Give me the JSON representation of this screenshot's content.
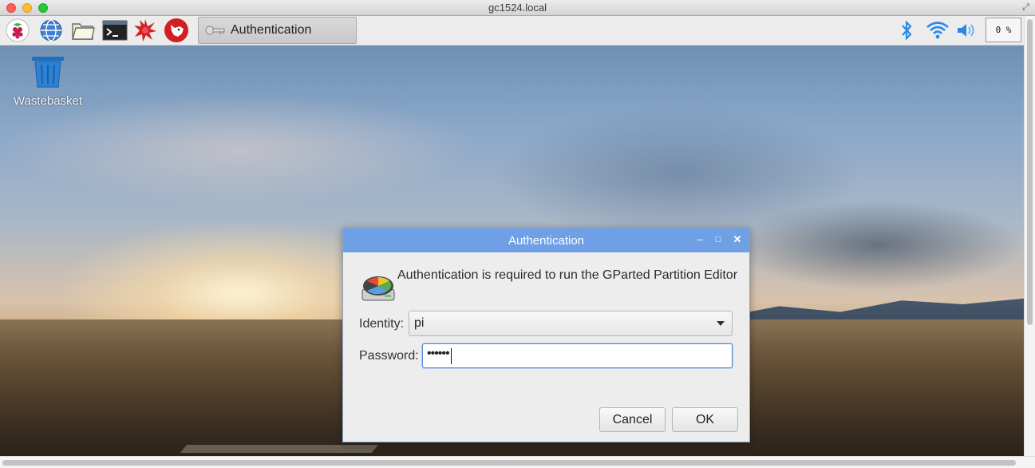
{
  "window": {
    "title": "gc1524.local",
    "controls": [
      "close",
      "minimize",
      "zoom"
    ]
  },
  "panel": {
    "launchers": [
      {
        "icon": "raspberry-icon"
      },
      {
        "icon": "web-browser-globe-icon"
      },
      {
        "icon": "file-manager-folder-icon"
      },
      {
        "icon": "terminal-icon"
      },
      {
        "icon": "math-kernel-burst-icon"
      },
      {
        "icon": "wolfram-wolf-icon"
      }
    ],
    "task": {
      "icon": "key-icon",
      "label": "Authentication"
    },
    "tray": {
      "bluetooth": "bluetooth-icon",
      "wifi": "wifi-icon",
      "volume": "volume-icon",
      "cpu_label": "0 %"
    }
  },
  "desktop": {
    "wastebasket_label": "Wastebasket"
  },
  "dialog": {
    "title": "Authentication",
    "message": "Authentication is required to run the GParted Partition Editor",
    "identity_label": "Identity:",
    "identity_value": "pi",
    "password_label": "Password:",
    "password_value": "••••••",
    "cancel_label": "Cancel",
    "ok_label": "OK",
    "accent": "#6fa0e6"
  }
}
